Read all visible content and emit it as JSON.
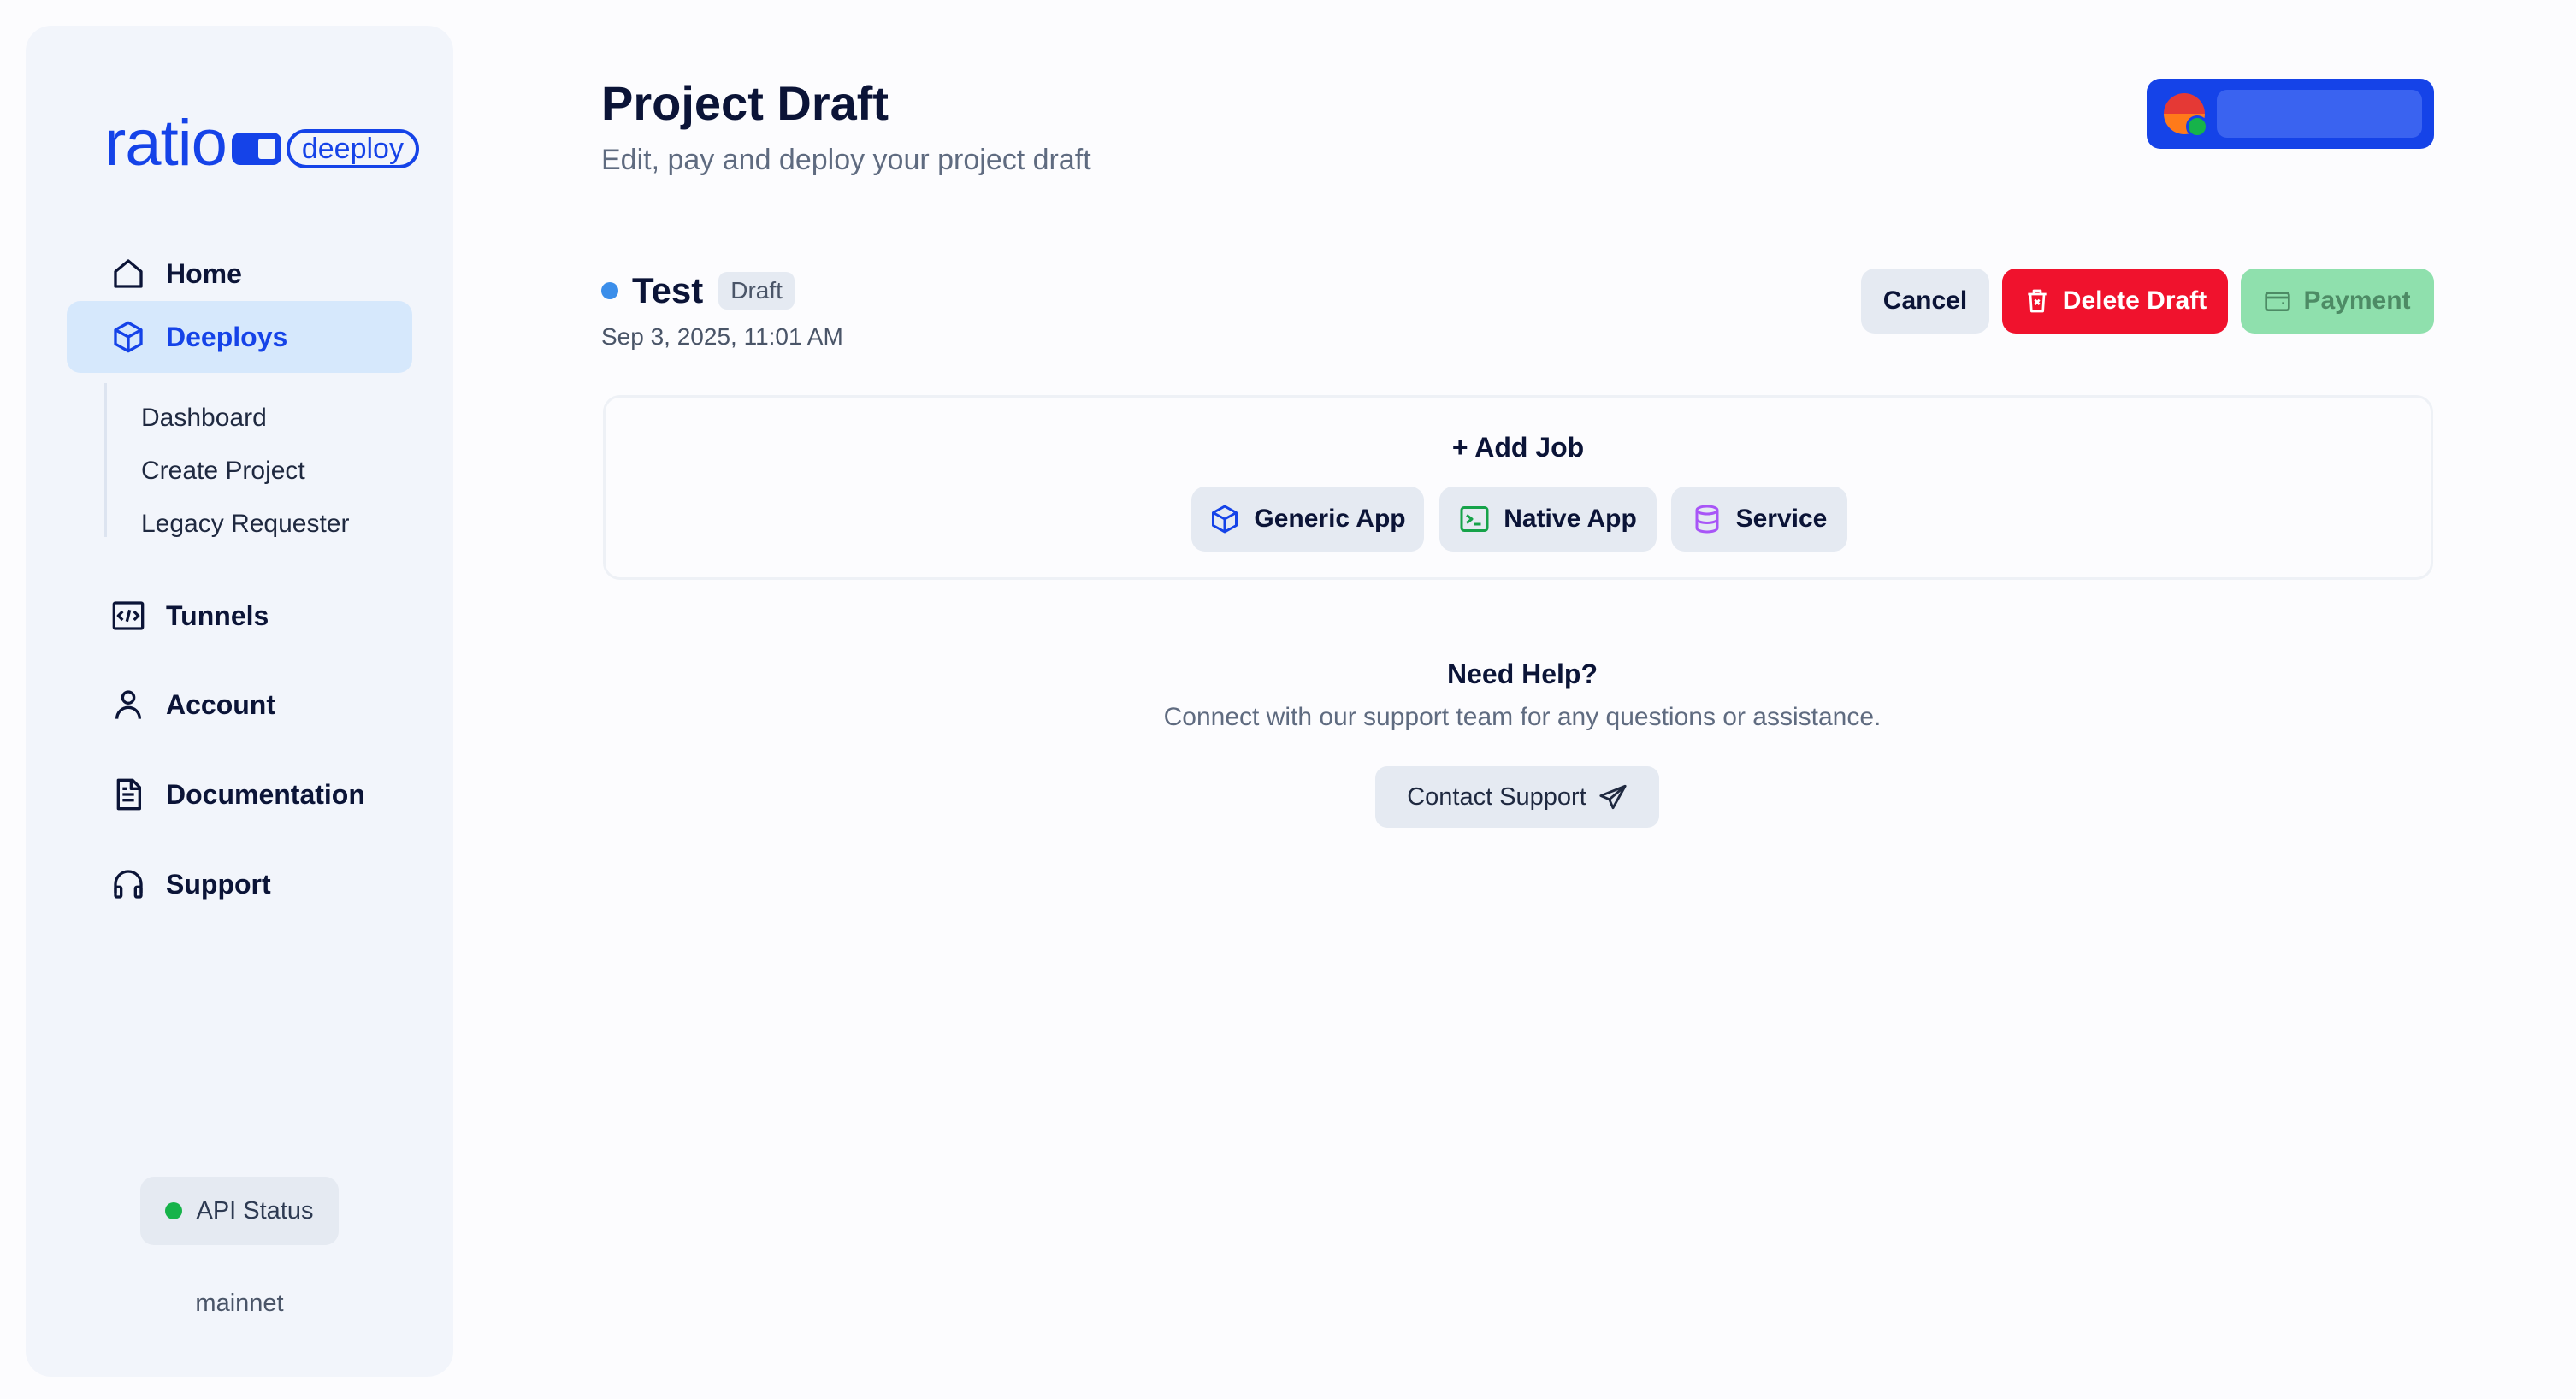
{
  "sidebar": {
    "logo_text": "ratio",
    "logo_pill": "deeploy",
    "nav": [
      {
        "label": "Home",
        "icon": "home-icon"
      },
      {
        "label": "Deeploys",
        "icon": "cube-icon",
        "active": true
      },
      {
        "label": "Tunnels",
        "icon": "code-tunnel-icon"
      },
      {
        "label": "Account",
        "icon": "user-icon"
      },
      {
        "label": "Documentation",
        "icon": "document-icon"
      },
      {
        "label": "Support",
        "icon": "headphones-icon"
      }
    ],
    "subnav": [
      "Dashboard",
      "Create Project",
      "Legacy Requester"
    ],
    "api_status": "API Status",
    "network": "mainnet"
  },
  "header": {
    "title": "Project Draft",
    "subtitle": "Edit, pay and deploy your project draft"
  },
  "project": {
    "name": "Test",
    "badge": "Draft",
    "date": "Sep 3, 2025, 11:01 AM"
  },
  "actions": {
    "cancel": "Cancel",
    "delete": "Delete Draft",
    "payment": "Payment"
  },
  "jobs": {
    "add_label": "+ Add Job",
    "types": [
      "Generic App",
      "Native App",
      "Service"
    ]
  },
  "help": {
    "title": "Need Help?",
    "text": "Connect with our support team for any questions or assistance.",
    "contact": "Contact Support"
  },
  "colors": {
    "accent": "#1543e8",
    "danger": "#f0122d",
    "success": "#8fe0ad",
    "status_green": "#16b34a"
  }
}
